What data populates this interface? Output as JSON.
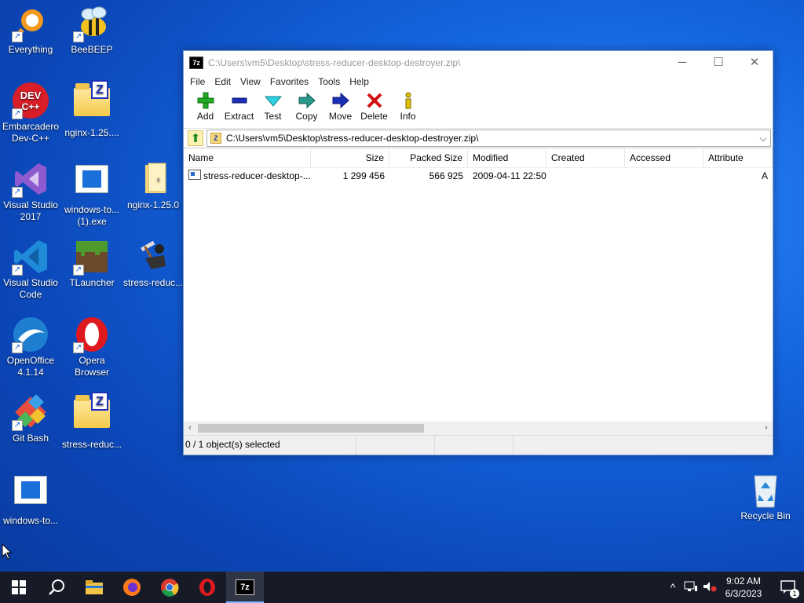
{
  "desktop": {
    "icons": [
      {
        "label": "Everything"
      },
      {
        "label": "BeeBEEP"
      },
      {
        "label": "Embarcadero Dev-C++"
      },
      {
        "label": "nginx-1.25...."
      },
      {
        "label": "Visual Studio 2017"
      },
      {
        "label": "windows-to... (1).exe"
      },
      {
        "label": "nginx-1.25.0"
      },
      {
        "label": "Visual Studio Code"
      },
      {
        "label": "TLauncher"
      },
      {
        "label": "stress-reduc..."
      },
      {
        "label": "OpenOffice 4.1.14"
      },
      {
        "label": "Opera Browser"
      },
      {
        "label": "Git Bash"
      },
      {
        "label": "stress-reduc..."
      },
      {
        "label": "windows-to..."
      },
      {
        "label": "Recycle Bin"
      }
    ]
  },
  "window": {
    "title": "C:\\Users\\vm5\\Desktop\\stress-reducer-desktop-destroyer.zip\\",
    "app_icon": "7z",
    "menu": [
      "File",
      "Edit",
      "View",
      "Favorites",
      "Tools",
      "Help"
    ],
    "toolbar": [
      {
        "label": "Add",
        "icon": "plus-icon",
        "color": "#22aa22"
      },
      {
        "label": "Extract",
        "icon": "minus-icon",
        "color": "#1b2fb5"
      },
      {
        "label": "Test",
        "icon": "check-icon",
        "color": "#19b8c9"
      },
      {
        "label": "Copy",
        "icon": "copy-arrow-icon",
        "color": "#2a8a8a"
      },
      {
        "label": "Move",
        "icon": "move-arrow-icon",
        "color": "#1b2fb5"
      },
      {
        "label": "Delete",
        "icon": "delete-x-icon",
        "color": "#d01010"
      },
      {
        "label": "Info",
        "icon": "info-icon",
        "color": "#d8b000"
      }
    ],
    "address": "C:\\Users\\vm5\\Desktop\\stress-reducer-desktop-destroyer.zip\\",
    "columns": [
      "Name",
      "Size",
      "Packed Size",
      "Modified",
      "Created",
      "Accessed",
      "Attribute"
    ],
    "rows": [
      {
        "name": "stress-reducer-desktop-...",
        "size": "1 299 456",
        "packed": "566 925",
        "modified": "2009-04-11 22:50",
        "created": "",
        "accessed": "",
        "attr": "A"
      }
    ],
    "status": "0 / 1 object(s) selected"
  },
  "taskbar": {
    "time": "9:02 AM",
    "date": "6/3/2023",
    "notifications": "1"
  }
}
